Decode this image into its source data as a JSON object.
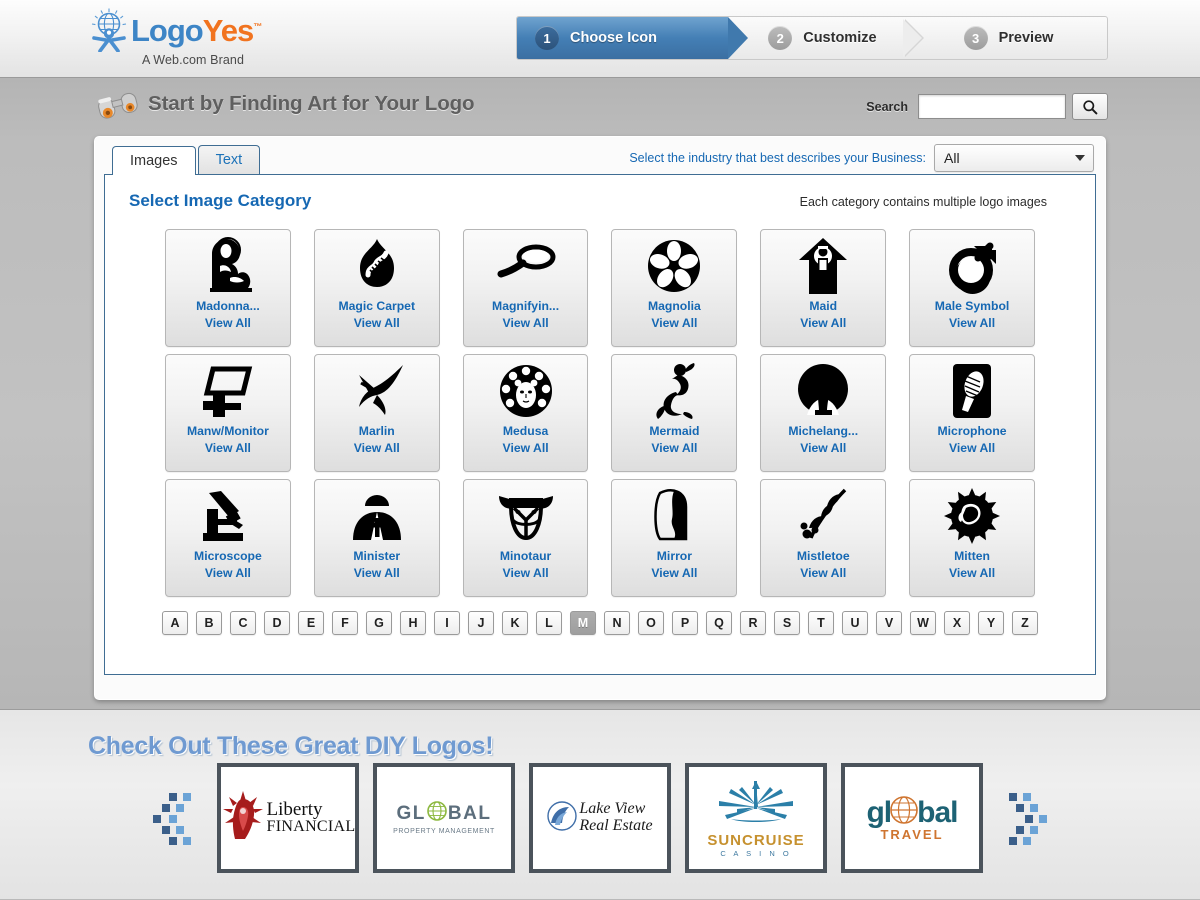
{
  "brand": {
    "logo_primary": "Logo",
    "logo_accent": "Yes",
    "trademark": "™",
    "tagline": "A Web.com Brand",
    "icon": "globe-person-icon"
  },
  "steps": [
    {
      "num": "1",
      "label": "Choose Icon",
      "state": "active"
    },
    {
      "num": "2",
      "label": "Customize",
      "state": "inactive"
    },
    {
      "num": "3",
      "label": "Preview",
      "state": "inactive"
    }
  ],
  "page": {
    "title": "Start by Finding Art for Your Logo",
    "title_icon": "binoculars-icon"
  },
  "search": {
    "label": "Search",
    "value": "",
    "placeholder": "",
    "button_icon": "search-icon"
  },
  "tabs": [
    {
      "label": "Images",
      "active": true
    },
    {
      "label": "Text",
      "active": false
    }
  ],
  "industry": {
    "label": "Select the industry that best describes your Business:",
    "selected": "All",
    "caret_icon": "chevron-down-icon"
  },
  "section": {
    "title": "Select Image Category",
    "note": "Each category contains multiple logo images",
    "view_all_label": "View All"
  },
  "categories": [
    {
      "name": "Madonna...",
      "art": "madonna-icon"
    },
    {
      "name": "Magic Carpet",
      "art": "magic-carpet-icon"
    },
    {
      "name": "Magnifyin...",
      "art": "magnifying-glass-icon"
    },
    {
      "name": "Magnolia",
      "art": "magnolia-flower-icon"
    },
    {
      "name": "Maid",
      "art": "maid-icon"
    },
    {
      "name": "Male Symbol",
      "art": "male-symbol-icon"
    },
    {
      "name": "Manw/Monitor",
      "art": "man-with-monitor-icon"
    },
    {
      "name": "Marlin",
      "art": "marlin-fish-icon"
    },
    {
      "name": "Medusa",
      "art": "medusa-head-icon"
    },
    {
      "name": "Mermaid",
      "art": "mermaid-icon"
    },
    {
      "name": "Michelang...",
      "art": "michelangelo-david-icon"
    },
    {
      "name": "Microphone",
      "art": "microphone-icon"
    },
    {
      "name": "Microscope",
      "art": "microscope-icon"
    },
    {
      "name": "Minister",
      "art": "minister-icon"
    },
    {
      "name": "Minotaur",
      "art": "minotaur-head-icon"
    },
    {
      "name": "Mirror",
      "art": "mirror-icon"
    },
    {
      "name": "Mistletoe",
      "art": "mistletoe-sprig-icon"
    },
    {
      "name": "Mitten",
      "art": "mitten-icon"
    }
  ],
  "alphabet": {
    "letters": [
      "A",
      "B",
      "C",
      "D",
      "E",
      "F",
      "G",
      "H",
      "I",
      "J",
      "K",
      "L",
      "M",
      "N",
      "O",
      "P",
      "Q",
      "R",
      "S",
      "T",
      "U",
      "V",
      "W",
      "X",
      "Y",
      "Z"
    ],
    "active": "M"
  },
  "footer": {
    "title": "Check Out These Great DIY Logos!",
    "decor_icon": "pixel-dots-icon",
    "logos": [
      {
        "name": "Liberty FINANCIAL",
        "line1": "Liberty",
        "line2": "FINANCIAL",
        "art": "statue-of-liberty-icon"
      },
      {
        "name": "GLOBAL Property Management",
        "line1": "GL",
        "line1b": "BAL",
        "line2": "PROPERTY MANAGEMENT",
        "art": "globe-icon"
      },
      {
        "name": "Lake View Real Estate",
        "line1": "Lake View",
        "line2": "Real Estate",
        "art": "wave-swirl-icon"
      },
      {
        "name": "SUNCRUISE CASINO",
        "line1": "SUNCRUISE",
        "line2": "C A S I N O",
        "art": "sunburst-ship-icon"
      },
      {
        "name": "global TRAVEL",
        "line1a": "gl",
        "line1b": "bal",
        "line2": "TRAVEL",
        "art": "globe-ball-icon"
      }
    ]
  },
  "colors": {
    "brand_blue": "#3d85c6",
    "brand_orange": "#f1731f",
    "link_blue": "#1668b3",
    "step_active": "#447fb5",
    "panel_border": "#3f6d93"
  }
}
